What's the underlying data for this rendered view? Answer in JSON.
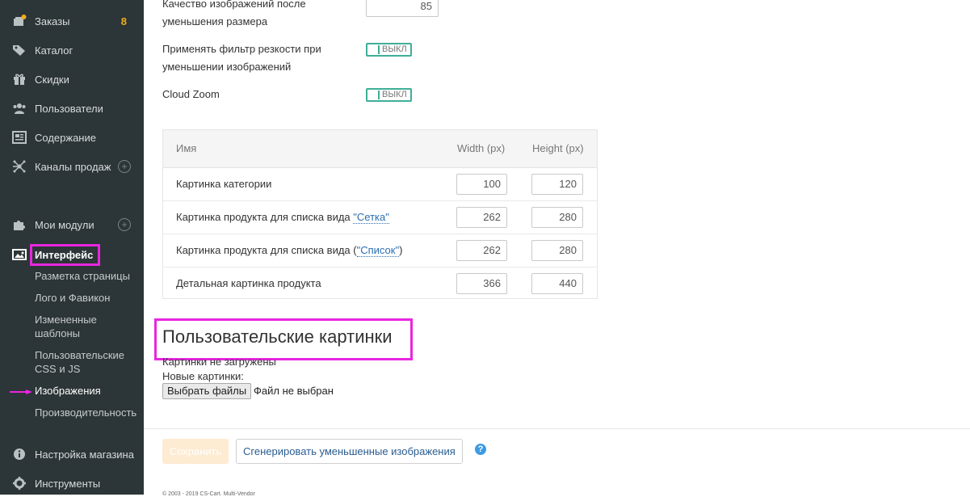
{
  "sidebar": {
    "items": [
      {
        "label": "Заказы",
        "badge": "8",
        "icon": "orders-icon"
      },
      {
        "label": "Каталог",
        "icon": "tag-icon"
      },
      {
        "label": "Скидки",
        "icon": "gift-icon"
      },
      {
        "label": "Пользователи",
        "icon": "users-icon"
      },
      {
        "label": "Содержание",
        "icon": "newspaper-icon"
      },
      {
        "label": "Каналы продаж",
        "icon": "network-icon",
        "add": "+"
      },
      {
        "label": "Мои модули",
        "icon": "puzzle-icon",
        "add": "+"
      },
      {
        "label": "Интерфейс",
        "icon": "image-icon"
      },
      {
        "label": "Настройка магазина",
        "icon": "info-icon"
      },
      {
        "label": "Инструменты",
        "icon": "gear-icon"
      }
    ],
    "interface_subitems": [
      "Разметка страницы",
      "Лого и Фавикон",
      "Измененные шаблоны",
      "Пользовательские CSS и JS",
      "Изображения",
      "Производительность"
    ]
  },
  "settings": {
    "quality_label": "Качество изображений после уменьшения размера",
    "quality_value": "85",
    "sharpen_label": "Применять фильтр резкости при уменьшении изображений",
    "sharpen_state": "ВЫКЛ",
    "cloudzoom_label": "Cloud Zoom",
    "cloudzoom_state": "ВЫКЛ"
  },
  "table": {
    "headers": {
      "name": "Имя",
      "width": "Width (px)",
      "height": "Height (px)"
    },
    "rows": [
      {
        "prefix": "Картинка категории",
        "link": "",
        "suffix": "",
        "width": "100",
        "height": "120"
      },
      {
        "prefix": "Картинка продукта для списка вида ",
        "link": "\"Сетка\"",
        "suffix": "",
        "width": "262",
        "height": "280"
      },
      {
        "prefix": "Картинка продукта для списка вида (",
        "link": "\"Список\"",
        "suffix": ")",
        "width": "262",
        "height": "280"
      },
      {
        "prefix": "Детальная картинка продукта",
        "link": "",
        "suffix": "",
        "width": "366",
        "height": "440"
      }
    ]
  },
  "custom_images": {
    "title": "Пользовательские картинки",
    "none_loaded": "Картинки не загружены",
    "new_label": "Новые картинки:",
    "choose_button": "Выбрать файлы",
    "file_status": "Файл не выбран"
  },
  "footer": {
    "save_label": "Сохранить",
    "generate_label": "Сгенерировать уменьшенные изображения",
    "help_glyph": "?",
    "copyright": "© 2003 - 2019 CS-Cart. Multi-Vendor"
  },
  "colors": {
    "sidebar_bg": "#2c3537",
    "highlight": "#e826e0",
    "badge": "#f0ad1c",
    "toggle": "#3fae98",
    "link": "#2a6fb0",
    "save_disabled": "#fdebd2",
    "help": "#3c9be3"
  }
}
